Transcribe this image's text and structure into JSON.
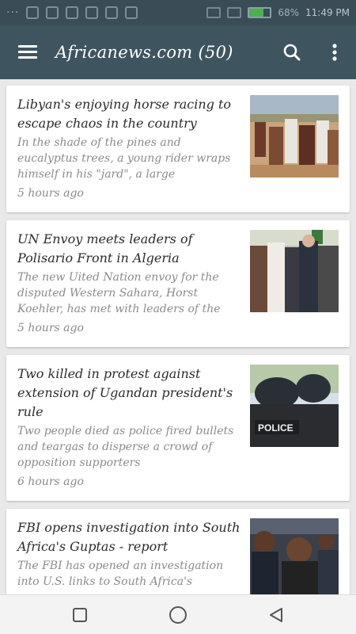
{
  "status_bar": {
    "battery_percent": "68%",
    "time": "11:49 PM"
  },
  "app_bar": {
    "title": "Africanews.com (50)",
    "search_icon": "search-icon",
    "overflow_icon": "more-vert-icon",
    "color": "#3e5560"
  },
  "articles": [
    {
      "title": "Libyan's enjoying horse racing to escape chaos in the country",
      "description": "In the shade of the pines and eucalyptus trees, a young rider wraps himself in his \"jard\", a large",
      "time": "5 hours ago"
    },
    {
      "title": "UN Envoy meets leaders of Polisario Front in Algeria",
      "description": "The new Uited Nation envoy for the disputed Western Sahara, Horst Koehler, has met with leaders of the",
      "time": "5 hours ago"
    },
    {
      "title": "Two killed in protest against extension of Ugandan president's rule",
      "description": "Two people died as police fired bullets and teargas to disperse a crowd of opposition supporters",
      "time": "6 hours ago"
    },
    {
      "title": "FBI opens investigation into South Africa's Guptas - report",
      "description": "The FBI has opened an investigation into U.S. links to South Africa's",
      "time": ""
    }
  ],
  "thumb3_label": "POLICE",
  "nav": {
    "recents_icon": "square-icon",
    "home_icon": "circle-icon",
    "back_icon": "triangle-back-icon"
  }
}
